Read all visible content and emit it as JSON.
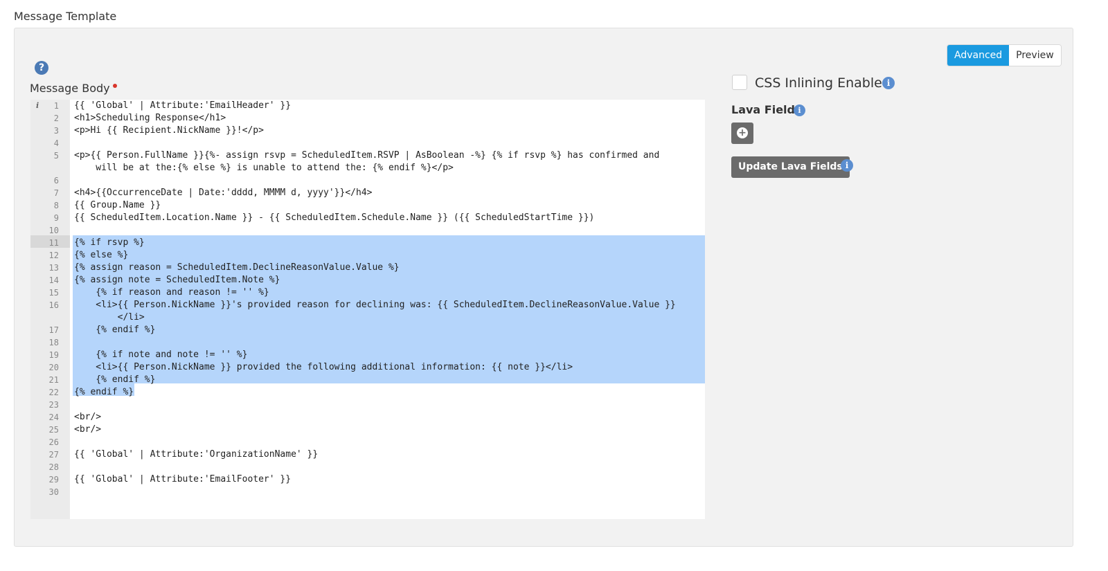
{
  "page": {
    "title": "Message Template"
  },
  "toolbar": {
    "advanced_label": "Advanced",
    "preview_label": "Preview",
    "active_color": "#1a9ae0"
  },
  "editor": {
    "label": "Message Body",
    "required": true,
    "gutter_info_icon": "i",
    "selected_lines": [
      11,
      22
    ],
    "lines": [
      {
        "n": "1",
        "text": "{{ 'Global' | Attribute:'EmailHeader' }}"
      },
      {
        "n": "2",
        "text": "<h1>Scheduling Response</h1>"
      },
      {
        "n": "3",
        "text": "<p>Hi {{ Recipient.NickName }}!</p>"
      },
      {
        "n": "4",
        "text": ""
      },
      {
        "n": "5",
        "text": "<p>{{ Person.FullName }}{%- assign rsvp = ScheduledItem.RSVP | AsBoolean -%} {% if rsvp %} has confirmed and"
      },
      {
        "n": "",
        "text": "    will be at the:{% else %} is unable to attend the: {% endif %}</p>"
      },
      {
        "n": "6",
        "text": ""
      },
      {
        "n": "7",
        "text": "<h4>{{OccurrenceDate | Date:'dddd, MMMM d, yyyy'}}</h4>"
      },
      {
        "n": "8",
        "text": "{{ Group.Name }}"
      },
      {
        "n": "9",
        "text": "{{ ScheduledItem.Location.Name }} - {{ ScheduledItem.Schedule.Name }} ({{ ScheduledStartTime }})"
      },
      {
        "n": "10",
        "text": ""
      },
      {
        "n": "11",
        "text": "{% if rsvp %}"
      },
      {
        "n": "12",
        "text": "{% else %}"
      },
      {
        "n": "13",
        "text": "{% assign reason = ScheduledItem.DeclineReasonValue.Value %}"
      },
      {
        "n": "14",
        "text": "{% assign note = ScheduledItem.Note %}"
      },
      {
        "n": "15",
        "text": "    {% if reason and reason != '' %}"
      },
      {
        "n": "16",
        "text": "    <li>{{ Person.NickName }}'s provided reason for declining was: {{ ScheduledItem.DeclineReasonValue.Value }}"
      },
      {
        "n": "",
        "text": "        </li>"
      },
      {
        "n": "17",
        "text": "    {% endif %}"
      },
      {
        "n": "18",
        "text": ""
      },
      {
        "n": "19",
        "text": "    {% if note and note != '' %}"
      },
      {
        "n": "20",
        "text": "    <li>{{ Person.NickName }} provided the following additional information: {{ note }}</li>"
      },
      {
        "n": "21",
        "text": "    {% endif %}"
      },
      {
        "n": "22",
        "text": "{% endif %}"
      },
      {
        "n": "23",
        "text": ""
      },
      {
        "n": "24",
        "text": "<br/>"
      },
      {
        "n": "25",
        "text": "<br/>"
      },
      {
        "n": "26",
        "text": ""
      },
      {
        "n": "27",
        "text": "{{ 'Global' | Attribute:'OrganizationName' }}"
      },
      {
        "n": "28",
        "text": ""
      },
      {
        "n": "29",
        "text": "{{ 'Global' | Attribute:'EmailFooter' }}"
      },
      {
        "n": "30",
        "text": ""
      }
    ]
  },
  "sidebar": {
    "css_inlining_label": "CSS Inlining Enabled",
    "css_inlining_checked": false,
    "lava_fields_label": "Lava Fields",
    "add_icon": "plus-circle-icon",
    "update_button_label": "Update Lava Fields"
  },
  "icons": {
    "help": "question-circle-icon",
    "info": "info-circle-icon",
    "help_glyph": "?",
    "info_glyph": "i",
    "add_glyph": "+"
  }
}
